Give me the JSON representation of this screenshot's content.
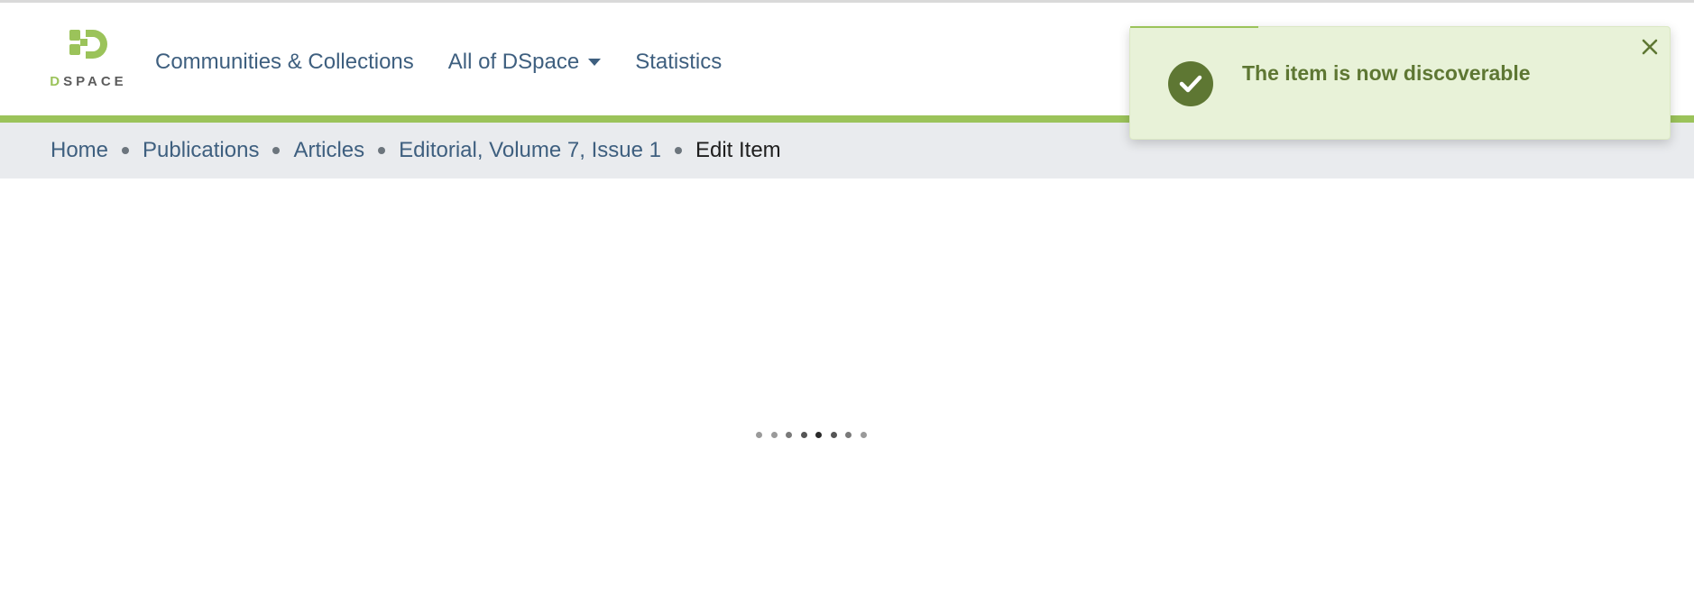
{
  "header": {
    "logo": {
      "text_d": "D",
      "text_rest": "SPACE",
      "icon": "dspace-logo-icon"
    },
    "nav": [
      {
        "label": "Communities & Collections",
        "has_dropdown": false
      },
      {
        "label": "All of DSpace",
        "has_dropdown": true
      },
      {
        "label": "Statistics",
        "has_dropdown": false
      }
    ]
  },
  "breadcrumb": {
    "items": [
      "Home",
      "Publications",
      "Articles",
      "Editorial, Volume 7, Issue 1"
    ],
    "current": "Edit Item"
  },
  "loader": {
    "dot_colors": [
      "#9a9a9a",
      "#9a9a9a",
      "#7a7a7a",
      "#555555",
      "#2a2a2a",
      "#555555",
      "#7a7a7a",
      "#9a9a9a"
    ]
  },
  "toast": {
    "message": "The item is now discoverable",
    "icon": "check-circle-icon",
    "close_icon": "close-icon"
  },
  "colors": {
    "brand_green": "#9bc35a",
    "link": "#3e5f7f",
    "breadcrumb_bg": "#e9ebee",
    "toast_bg": "#e8f2d8",
    "toast_text": "#5e7733"
  }
}
